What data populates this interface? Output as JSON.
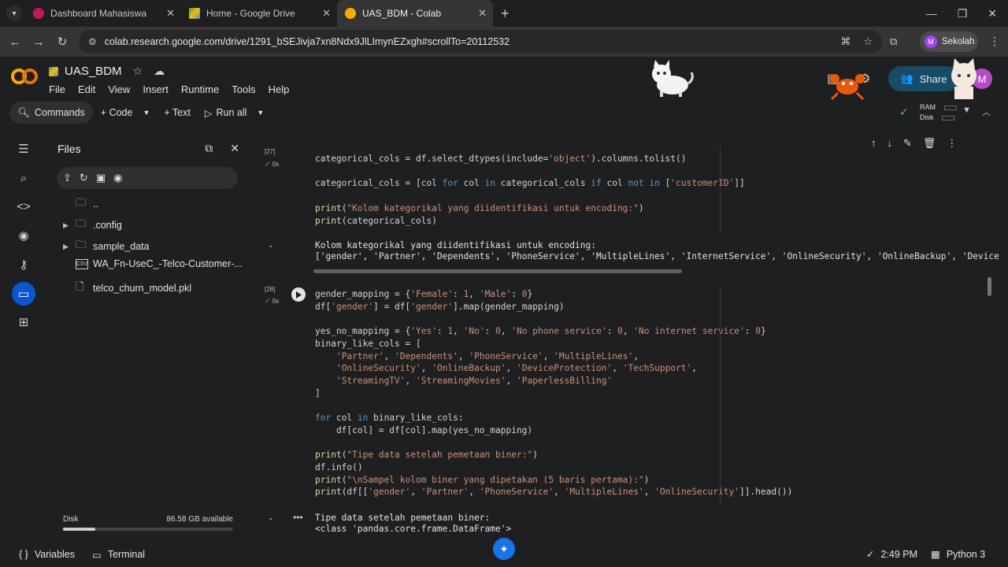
{
  "browser": {
    "tabs": [
      {
        "title": "Dashboard Mahasiswa",
        "active": false
      },
      {
        "title": "Home - Google Drive",
        "active": false
      },
      {
        "title": "UAS_BDM - Colab",
        "active": true
      }
    ],
    "url": "colab.research.google.com/drive/1291_bSEJivja7xn8Ndx9JlLImynEZxgh#scrollTo=20112532",
    "profile_label": "Sekolah",
    "profile_initial": "M"
  },
  "colab": {
    "notebook_title": "UAS_BDM",
    "menu": [
      "File",
      "Edit",
      "View",
      "Insert",
      "Runtime",
      "Tools",
      "Help"
    ],
    "share_label": "Share",
    "user_initial": "M",
    "toolbar": {
      "commands": "Commands",
      "code": "+ Code",
      "text": "+ Text",
      "run_all": "Run all",
      "ram": "RAM",
      "disk": "Disk"
    }
  },
  "files": {
    "title": "Files",
    "items": [
      {
        "name": "..",
        "type": "folder",
        "expandable": false
      },
      {
        "name": ".config",
        "type": "folder",
        "expandable": true
      },
      {
        "name": "sample_data",
        "type": "folder",
        "expandable": true
      },
      {
        "name": "WA_Fn-UseC_-Telco-Customer-...",
        "type": "csv",
        "expandable": false
      },
      {
        "name": "telco_churn_model.pkl",
        "type": "file",
        "expandable": false
      }
    ],
    "disk_label": "Disk",
    "disk_available": "86.58 GB available",
    "disk_used_fraction": 0.19
  },
  "cells": {
    "cell27": {
      "exec": "[27]",
      "status": "0s",
      "output": "Kolom kategorikal yang diidentifikasi untuk encoding:\n['gender', 'Partner', 'Dependents', 'PhoneService', 'MultipleLines', 'InternetService', 'OnlineSecurity', 'OnlineBackup', 'DevicePro"
    },
    "cell28": {
      "exec": "[28]",
      "status": "0s",
      "output": "Tipe data setelah pemetaan biner:\n<class 'pandas.core.frame.DataFrame'>"
    }
  },
  "statusbar": {
    "variables": "Variables",
    "terminal": "Terminal",
    "time": "2:49 PM",
    "runtime": "Python 3"
  },
  "colors": {
    "accent": "#0b57d0",
    "share_bg": "#174b66",
    "ok": "#5bb974"
  }
}
